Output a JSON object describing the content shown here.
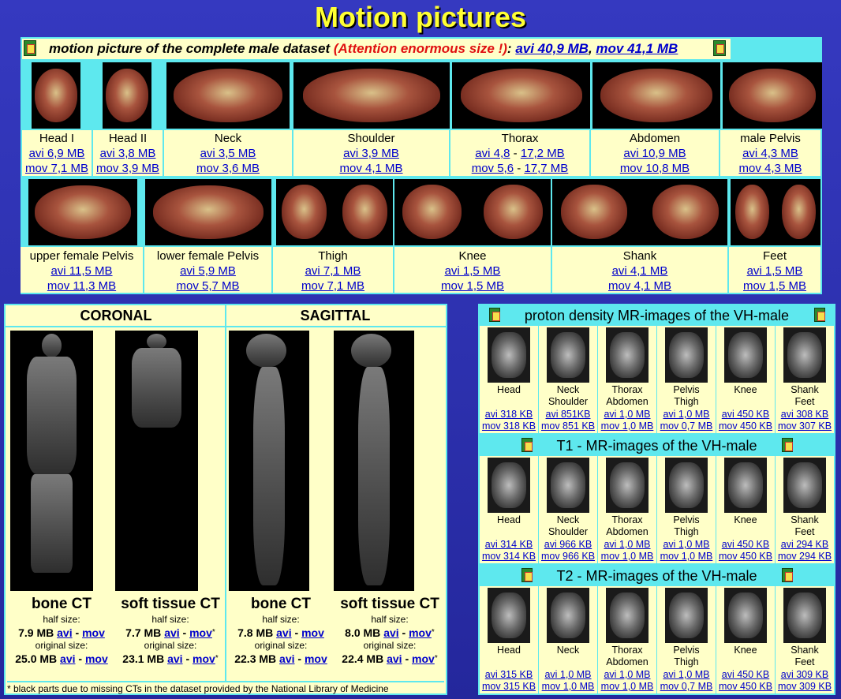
{
  "title": "Motion pictures",
  "complete": {
    "text": "motion picture of the complete male dataset",
    "warning": "(Attention enormous size !)",
    "colon": ":",
    "avi": "avi 40,9 MB",
    "comma": ",",
    "mov": "mov 41,1 MB"
  },
  "row1": [
    {
      "label": "Head I",
      "avi": "avi 6,9 MB",
      "mov": "mov 7,1 MB"
    },
    {
      "label": "Head II",
      "avi": "avi 3,8 MB",
      "mov": "mov 3,9 MB"
    },
    {
      "label": "Neck",
      "avi": "avi 3,5 MB",
      "mov": "mov 3,6 MB"
    },
    {
      "label": "Shoulder",
      "avi": "avi 3,9 MB",
      "mov": "mov 4,1 MB"
    },
    {
      "label": "Thorax",
      "avi": "avi 4,8",
      "avi_sep": " - ",
      "avi2": "17,2 MB",
      "mov": "mov 5,6",
      "mov_sep": " - ",
      "mov2": "17,7 MB"
    },
    {
      "label": "Abdomen",
      "avi": "avi 10,9 MB",
      "mov": "mov 10,8 MB"
    },
    {
      "label": "male Pelvis",
      "avi": "avi 4,3 MB",
      "mov": "mov 4,3 MB"
    }
  ],
  "row2": [
    {
      "label": "upper female Pelvis",
      "avi": "avi 11,5 MB",
      "mov": "mov 11,3 MB"
    },
    {
      "label": "lower female Pelvis",
      "avi": "avi 5,9 MB",
      "mov": "mov 5,7 MB"
    },
    {
      "label": "Thigh",
      "avi": "avi 7,1 MB",
      "mov": "mov 7,1 MB"
    },
    {
      "label": "Knee",
      "avi": "avi 1,5 MB",
      "mov": "mov 1,5 MB"
    },
    {
      "label": "Shank",
      "avi": "avi 4,1 MB",
      "mov": "mov 4,1 MB"
    },
    {
      "label": "Feet",
      "avi": "avi 1,5 MB",
      "mov": "mov 1,5 MB"
    }
  ],
  "ct": {
    "coronal": "CORONAL",
    "sagittal": "SAGITTAL",
    "items": [
      {
        "name": "bone CT",
        "half_label": "half size:",
        "half_size": "7.9 MB",
        "half_avi": "avi",
        "dash": " - ",
        "half_mov": "mov",
        "half_star": "",
        "orig_label": "original size:",
        "orig_size": "25.0 MB",
        "orig_avi": "avi",
        "orig_mov": "mov",
        "orig_star": ""
      },
      {
        "name": "soft tissue CT",
        "half_label": "half size:",
        "half_size": "7.7 MB",
        "half_avi": "avi",
        "dash": " - ",
        "half_mov": "mov",
        "half_star": "*",
        "orig_label": "original size:",
        "orig_size": "23.1 MB",
        "orig_avi": "avi",
        "orig_mov": "mov",
        "orig_star": "*"
      },
      {
        "name": "bone CT",
        "half_label": "half size:",
        "half_size": "7.8 MB",
        "half_avi": "avi",
        "dash": " - ",
        "half_mov": "mov",
        "half_star": "",
        "orig_label": "original size:",
        "orig_size": "22.3 MB",
        "orig_avi": "avi",
        "orig_mov": "mov",
        "orig_star": ""
      },
      {
        "name": "soft tissue CT",
        "half_label": "half size:",
        "half_size": "8.0 MB",
        "half_avi": "avi",
        "dash": " - ",
        "half_mov": "mov",
        "half_star": "*",
        "orig_label": "original size:",
        "orig_size": "22.4 MB",
        "orig_avi": "avi",
        "orig_mov": "mov",
        "orig_star": "*"
      }
    ],
    "footnote": "* black parts due to missing CTs in the dataset provided by the National Library of Medicine"
  },
  "mri": [
    {
      "title": "proton density MR-images of the VH-male",
      "items": [
        {
          "l1": "Head",
          "l2": "",
          "avi": "avi 318 KB",
          "mov": "mov 318 KB"
        },
        {
          "l1": "Neck",
          "l2": "Shoulder",
          "avi": "avi 851KB",
          "mov": "mov 851 KB"
        },
        {
          "l1": "Thorax",
          "l2": "Abdomen",
          "avi": "avi 1,0 MB",
          "mov": "mov 1,0 MB"
        },
        {
          "l1": "Pelvis",
          "l2": "Thigh",
          "avi": "avi 1,0 MB",
          "mov": "mov 0,7 MB"
        },
        {
          "l1": "Knee",
          "l2": "",
          "avi": "avi 450 KB",
          "mov": "mov 450 KB"
        },
        {
          "l1": "Shank",
          "l2": "Feet",
          "avi": "avi 308 KB",
          "mov": "mov 307 KB"
        }
      ]
    },
    {
      "title": "T1 - MR-images of the VH-male",
      "items": [
        {
          "l1": "Head",
          "l2": "",
          "avi": "avi 314 KB",
          "mov": "mov 314 KB"
        },
        {
          "l1": "Neck",
          "l2": "Shoulder",
          "avi": "avi 966 KB",
          "mov": "mov 966 KB"
        },
        {
          "l1": "Thorax",
          "l2": "Abdomen",
          "avi": "avi 1,0 MB",
          "mov": "mov 1,0 MB"
        },
        {
          "l1": "Pelvis",
          "l2": "Thigh",
          "avi": "avi 1,0 MB",
          "mov": "mov 1,0 MB"
        },
        {
          "l1": "Knee",
          "l2": "",
          "avi": "avi 450 KB",
          "mov": "mov 450 KB"
        },
        {
          "l1": "Shank",
          "l2": "Feet",
          "avi": "avi 294 KB",
          "mov": "mov 294 KB"
        }
      ]
    },
    {
      "title": "T2 - MR-images of the VH-male",
      "items": [
        {
          "l1": "Head",
          "l2": "",
          "avi": "avi 315 KB",
          "mov": "mov 315 KB"
        },
        {
          "l1": "Neck",
          "l2": "",
          "avi": "avi 1,0 MB",
          "mov": "mov 1,0 MB"
        },
        {
          "l1": "Thorax",
          "l2": "Abdomen",
          "avi": "avi 1,0 MB",
          "mov": "mov 1,0 MB"
        },
        {
          "l1": "Pelvis",
          "l2": "Thigh",
          "avi": "avi 1,0 MB",
          "mov": "mov 0,7 MB"
        },
        {
          "l1": "Knee",
          "l2": "",
          "avi": "avi 450 KB",
          "mov": "mov 450 KB"
        },
        {
          "l1": "Shank",
          "l2": "Feet",
          "avi": "avi 309 KB",
          "mov": "mov 309 KB"
        }
      ]
    }
  ]
}
